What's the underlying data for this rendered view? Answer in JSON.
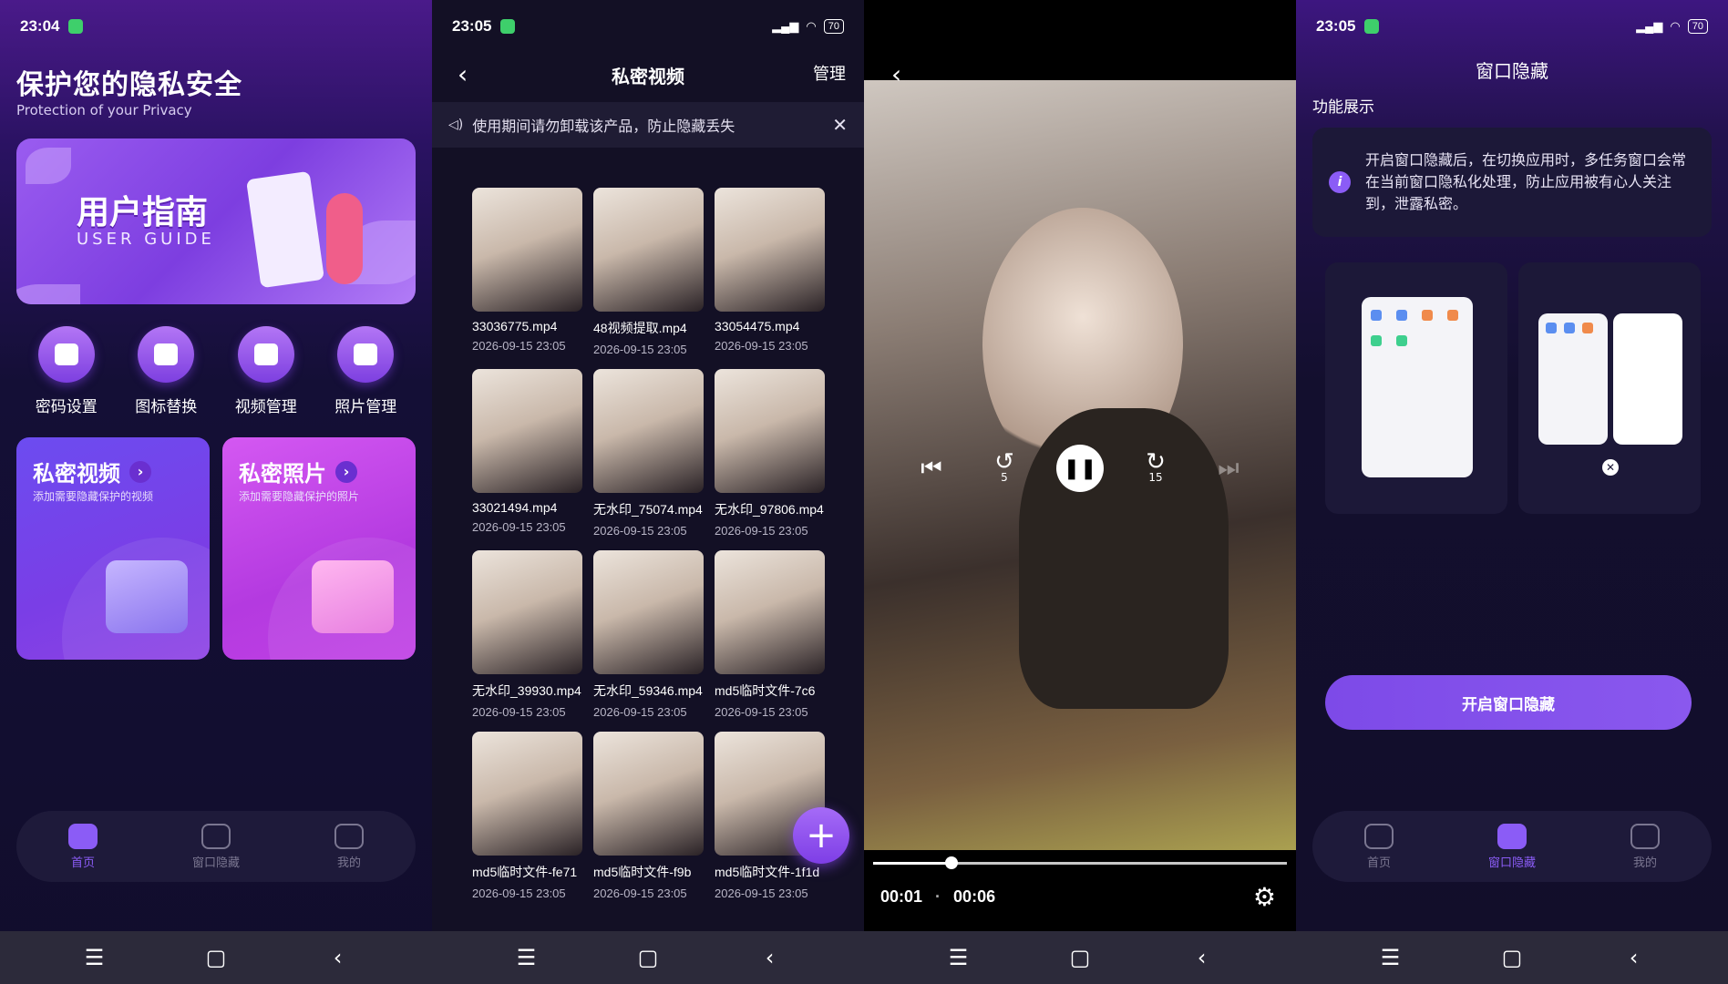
{
  "panel1": {
    "status": {
      "time": "23:04"
    },
    "hero_title": "保护您的隐私安全",
    "hero_sub": "Protection of your Privacy",
    "guide": {
      "title": "用户指南",
      "subtitle": "USER GUIDE"
    },
    "quick": [
      {
        "label": "密码设置",
        "icon": "lock-icon"
      },
      {
        "label": "图标替换",
        "icon": "apps-icon"
      },
      {
        "label": "视频管理",
        "icon": "video-icon"
      },
      {
        "label": "照片管理",
        "icon": "camera-icon"
      }
    ],
    "card_video": {
      "title": "私密视频",
      "sub": "添加需要隐藏保护的视频"
    },
    "card_photo": {
      "title": "私密照片",
      "sub": "添加需要隐藏保护的照片"
    },
    "tabs": [
      {
        "label": "首页",
        "active": true
      },
      {
        "label": "窗口隐藏",
        "active": false
      },
      {
        "label": "我的",
        "active": false
      }
    ]
  },
  "panel2": {
    "status": {
      "time": "23:05",
      "battery": "70"
    },
    "title": "私密视频",
    "manage": "管理",
    "notice": "使用期间请勿卸载该产品，防止隐藏丢失",
    "videos": [
      {
        "name": "33036775.mp4",
        "date": "2026-09-15 23:05"
      },
      {
        "name": "48视频提取.mp4",
        "date": "2026-09-15 23:05"
      },
      {
        "name": "33054475.mp4",
        "date": "2026-09-15 23:05"
      },
      {
        "name": "33021494.mp4",
        "date": "2026-09-15 23:05"
      },
      {
        "name": "无水印_75074.mp4",
        "date": "2026-09-15 23:05"
      },
      {
        "name": "无水印_97806.mp4",
        "date": "2026-09-15 23:05"
      },
      {
        "name": "无水印_39930.mp4",
        "date": "2026-09-15 23:05"
      },
      {
        "name": "无水印_59346.mp4",
        "date": "2026-09-15 23:05"
      },
      {
        "name": "md5临时文件-7c6",
        "date": "2026-09-15 23:05"
      },
      {
        "name": "md5临时文件-fe71",
        "date": "2026-09-15 23:05"
      },
      {
        "name": "md5临时文件-f9b",
        "date": "2026-09-15 23:05"
      },
      {
        "name": "md5临时文件-1f1d",
        "date": "2026-09-15 23:05"
      }
    ],
    "fab": "+"
  },
  "panel3": {
    "rewind_seconds": "5",
    "forward_seconds": "15",
    "current_time": "00:01",
    "separator": "·",
    "duration": "00:06",
    "progress": 0.19
  },
  "panel4": {
    "status": {
      "time": "23:05",
      "battery": "70"
    },
    "title": "窗口隐藏",
    "section": "功能展示",
    "info": "开启窗口隐藏后，在切换应用时，多任务窗口会常在当前窗口隐私化处理，防止应用被有心人关注到，泄露私密。",
    "enable_button": "开启窗口隐藏",
    "tabs": [
      {
        "label": "首页",
        "active": false
      },
      {
        "label": "窗口隐藏",
        "active": true
      },
      {
        "label": "我的",
        "active": false
      }
    ]
  },
  "nav": {
    "menu": "☰",
    "home": "▢",
    "back": "‹"
  }
}
